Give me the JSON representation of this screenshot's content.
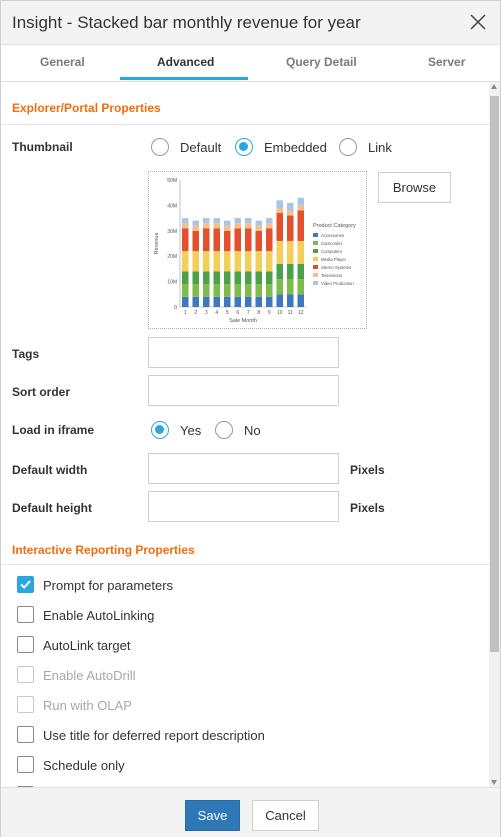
{
  "window": {
    "title": "Insight - Stacked bar monthly revenue for year"
  },
  "tabs": [
    {
      "label": "General"
    },
    {
      "label": "Advanced",
      "active": true
    },
    {
      "label": "Query Detail"
    },
    {
      "label": "Server"
    }
  ],
  "explorer": {
    "heading": "Explorer/Portal Properties",
    "thumbnail": {
      "label": "Thumbnail",
      "options": [
        "Default",
        "Embedded",
        "Link"
      ],
      "selected": "Embedded",
      "browse_label": "Browse"
    },
    "tags": {
      "label": "Tags",
      "value": ""
    },
    "sort_order": {
      "label": "Sort order",
      "value": ""
    },
    "load_in_iframe": {
      "label": "Load in iframe",
      "options": [
        "Yes",
        "No"
      ],
      "selected": "Yes"
    },
    "default_width": {
      "label": "Default width",
      "value": "",
      "unit": "Pixels"
    },
    "default_height": {
      "label": "Default height",
      "value": "",
      "unit": "Pixels"
    }
  },
  "reporting": {
    "heading": "Interactive Reporting Properties",
    "options": [
      {
        "label": "Prompt for parameters",
        "checked": true,
        "enabled": true
      },
      {
        "label": "Enable AutoLinking",
        "checked": false,
        "enabled": true
      },
      {
        "label": "AutoLink target",
        "checked": false,
        "enabled": true
      },
      {
        "label": "Enable AutoDrill",
        "checked": false,
        "enabled": false
      },
      {
        "label": "Run with OLAP",
        "checked": false,
        "enabled": false
      },
      {
        "label": "Use title for deferred report description",
        "checked": false,
        "enabled": true
      },
      {
        "label": "Schedule only",
        "checked": false,
        "enabled": true
      }
    ]
  },
  "footer": {
    "save_label": "Save",
    "cancel_label": "Cancel"
  },
  "colors": {
    "accent": "#2aa6e0",
    "section_heading": "#f26c0d",
    "save_button": "#2e78b8"
  },
  "chart_data": {
    "type": "bar",
    "stacked": true,
    "xlabel": "Sale Month",
    "ylabel": "Revenue",
    "ylim": [
      0,
      50
    ],
    "yticks": [
      "0",
      "10M",
      "20M",
      "30M",
      "40M",
      "50M"
    ],
    "categories": [
      "1",
      "2",
      "3",
      "4",
      "5",
      "6",
      "7",
      "8",
      "9",
      "10",
      "11",
      "12"
    ],
    "legend_title": "Product Category",
    "legend_position": "right",
    "series": [
      {
        "name": "Accessories",
        "color": "#3f78c2",
        "values": [
          4,
          4,
          4,
          4,
          4,
          4,
          4,
          4,
          4,
          5,
          5,
          5
        ]
      },
      {
        "name": "Camcorder",
        "color": "#7dbb4a",
        "values": [
          5,
          5,
          5,
          5,
          5,
          5,
          5,
          5,
          5,
          6,
          6,
          6
        ]
      },
      {
        "name": "Computers",
        "color": "#4aa24a",
        "values": [
          5,
          5,
          5,
          5,
          5,
          5,
          5,
          5,
          5,
          6,
          6,
          6
        ]
      },
      {
        "name": "Media Player",
        "color": "#f3cf5a",
        "values": [
          8,
          8,
          8,
          8,
          8,
          8,
          8,
          8,
          8,
          9,
          9,
          9
        ]
      },
      {
        "name": "Stereo Systems",
        "color": "#e3502d",
        "values": [
          9,
          8,
          9,
          9,
          8,
          9,
          9,
          8,
          9,
          11,
          10,
          12
        ]
      },
      {
        "name": "Televisions",
        "color": "#f2c08a",
        "values": [
          2,
          2,
          2,
          2,
          2,
          2,
          2,
          2,
          2,
          2,
          2,
          2
        ]
      },
      {
        "name": "Video Production",
        "color": "#a9c5e6",
        "values": [
          2,
          2,
          2,
          2,
          2,
          2,
          2,
          2,
          2,
          3,
          3,
          3
        ]
      }
    ]
  }
}
